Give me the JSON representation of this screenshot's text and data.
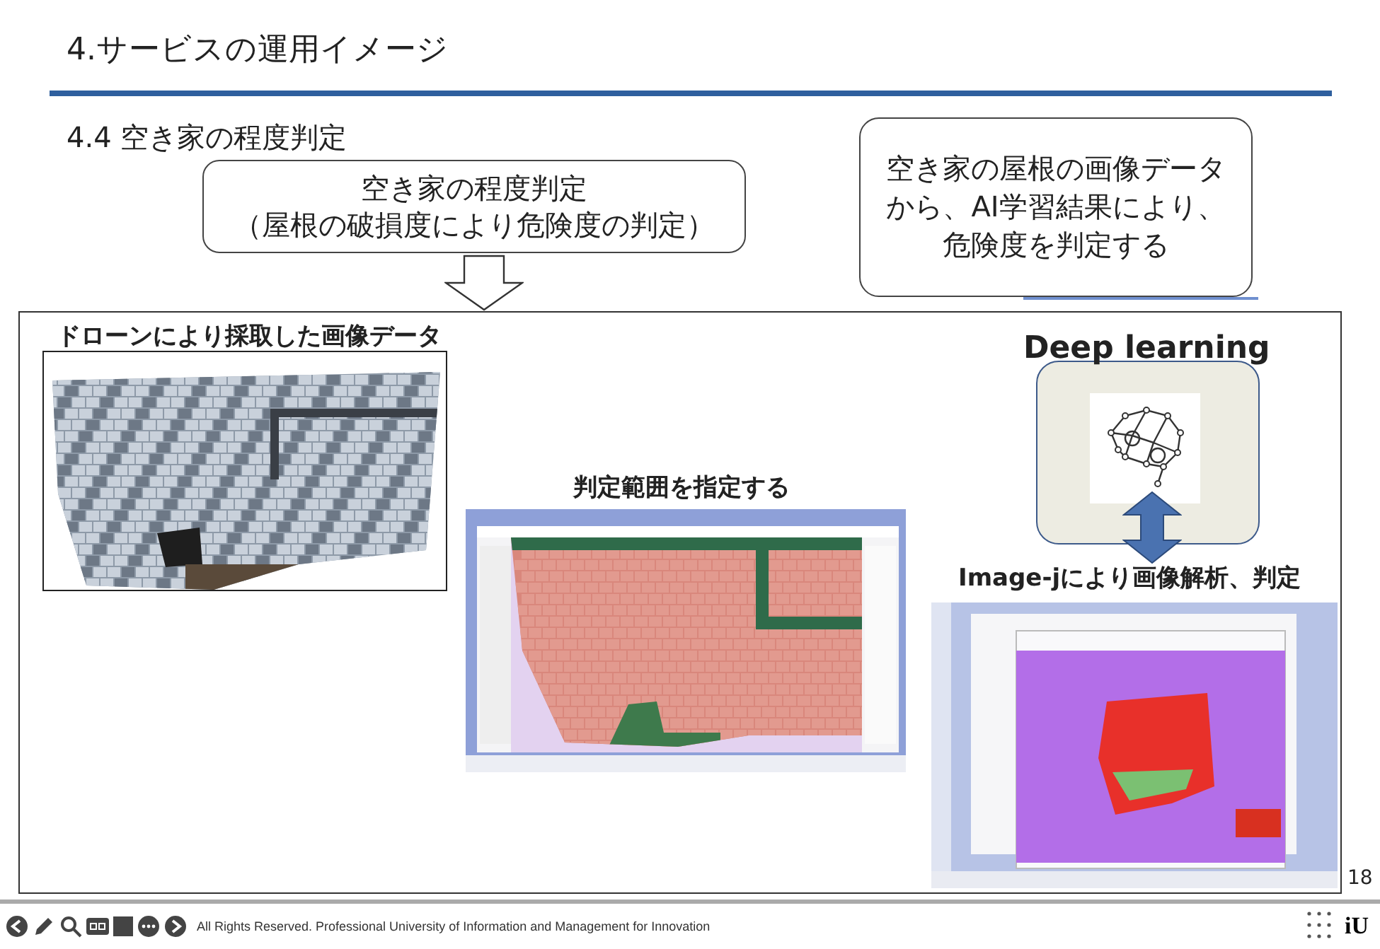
{
  "slide": {
    "title": "4.サービスの運用イメージ",
    "subtitle": "4.4 空き家の程度判定",
    "summary_box": {
      "lines": [
        "空き家の程度判定",
        "（屋根の破損度により危険度の判定）"
      ]
    },
    "note_box": {
      "text": "空き家の屋根の画像データから、AI学習結果により、危険度を判定する"
    },
    "panels": [
      {
        "kind": "photo",
        "caption": "ドローンにより採取した画像データ"
      },
      {
        "kind": "selection",
        "caption": "判定範囲を指定する"
      },
      {
        "kind": "analysis",
        "caption": "Image-jにより画像解析、判定"
      }
    ],
    "deep_learning": {
      "title": "Deep learning"
    },
    "page_number": "18"
  },
  "footer": {
    "text": "All Rights Reserved. Professional University of Information and Management for Innovation",
    "logo": "iU"
  }
}
